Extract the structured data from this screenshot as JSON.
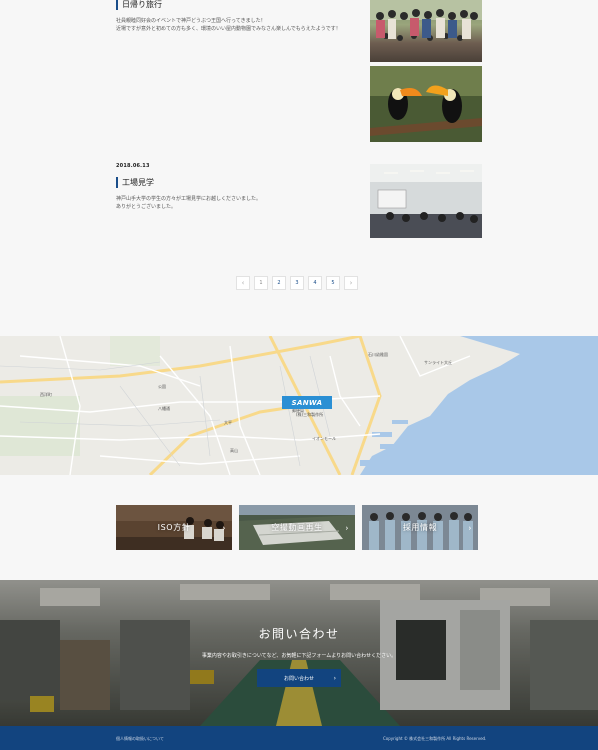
{
  "posts": [
    {
      "date": "",
      "title": "日帰り旅行",
      "lines": [
        "社員親睦同好会のイベントで神戸どうぶつ王国へ行ってきました！",
        "近場ですが意外と初めての方も多く、環境のいい屋内動物園でみなさん楽しんでもらえたようです！"
      ]
    },
    {
      "date": "2018.06.13",
      "title": "工場見学",
      "lines": [
        "神戸山手大学の学生の方々が工場見学にお越しくださいました。",
        "ありがとうございました。"
      ]
    }
  ],
  "pager": {
    "prev": "‹",
    "pages": [
      "1",
      "2",
      "3",
      "4",
      "5"
    ],
    "current": "1",
    "next": "›"
  },
  "map": {
    "pin": "SANWA",
    "labels": [
      "石川幼稚園",
      "サンライト大丘",
      "公園",
      "郵便局",
      "大平",
      "西洋町",
      "高山",
      "イオンモール",
      "(株)三和製作所",
      "八幡通"
    ]
  },
  "banners": [
    {
      "label": "ISO方針",
      "icon": "chevron-right-icon"
    },
    {
      "label": "空撮動画再生",
      "icon": "chevron-right-icon"
    },
    {
      "label": "採用情報",
      "icon": "chevron-right-icon"
    }
  ],
  "contact": {
    "title": "お問い合わせ",
    "text": "事業内容やお取引きについてなど、お気軽に下記フォームよりお問い合わせください。",
    "button": "お問い合わせ"
  },
  "footer": {
    "link": "個人情報の取扱いについて",
    "copyright": "Copyright © 株式会社三和製作所 All Rights Reserved."
  },
  "colors": {
    "brand": "#12447f",
    "pin": "#2a8fd4",
    "background": "#f7f7f7"
  }
}
